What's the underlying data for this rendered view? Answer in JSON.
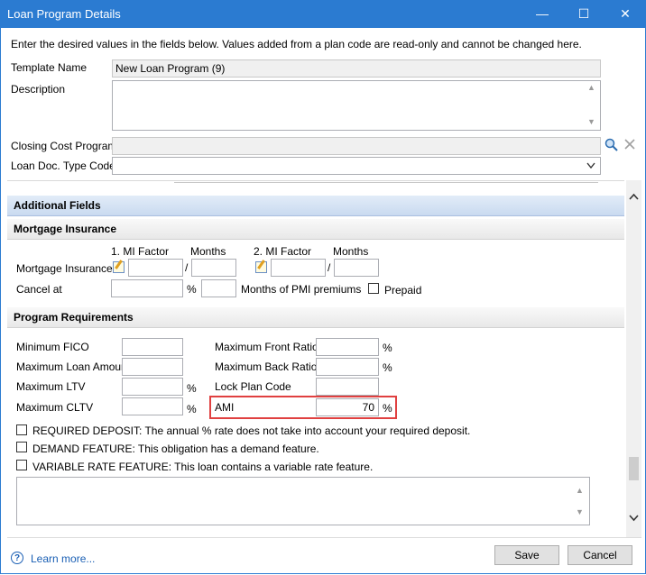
{
  "window": {
    "title": "Loan Program Details",
    "minimize": "—",
    "maximize": "☐",
    "close": "✕"
  },
  "instructions": "Enter the desired values in the fields below. Values added from a plan code are read-only and cannot be changed here.",
  "template_name": {
    "label": "Template Name",
    "value": "New Loan Program (9)"
  },
  "description": {
    "label": "Description",
    "value": ""
  },
  "closing_cost_program": {
    "label": "Closing Cost Program",
    "value": ""
  },
  "loan_doc_type_code": {
    "label": "Loan Doc. Type Code",
    "value": ""
  },
  "additional_fields": {
    "title": "Additional Fields"
  },
  "mortgage_insurance": {
    "title": "Mortgage Insurance",
    "mi_factor_1_header": "1. MI Factor",
    "months_1_header": "Months",
    "mi_factor_2_header": "2. MI Factor",
    "months_2_header": "Months",
    "row_label": "Mortgage Insurance",
    "slash": "/",
    "cancel_at_label": "Cancel at",
    "percent": "%",
    "months_pmi_label": "Months of PMI premiums",
    "prepaid_label": "Prepaid"
  },
  "program_requirements": {
    "title": "Program Requirements",
    "minimum_fico": "Minimum FICO",
    "maximum_loan_amount": "Maximum Loan Amount",
    "maximum_ltv": "Maximum LTV",
    "maximum_cltv": "Maximum CLTV",
    "maximum_front_ratio": "Maximum Front Ratio",
    "maximum_back_ratio": "Maximum Back Ratio",
    "lock_plan_code": "Lock Plan Code",
    "ami_label": "AMI",
    "ami_value": "70",
    "percent": "%"
  },
  "checkboxes": {
    "required_deposit": "REQUIRED DEPOSIT: The annual % rate does not take into account your required deposit.",
    "demand_feature": "DEMAND FEATURE: This obligation has a demand feature.",
    "variable_rate": "VARIABLE RATE FEATURE: This loan contains a variable rate feature."
  },
  "footer": {
    "help_icon": "?",
    "learn_more": "Learn more...",
    "save": "Save",
    "cancel": "Cancel"
  },
  "colors": {
    "titlebar": "#2b7bd1",
    "highlight": "#e04040",
    "link": "#1a5fb4"
  }
}
